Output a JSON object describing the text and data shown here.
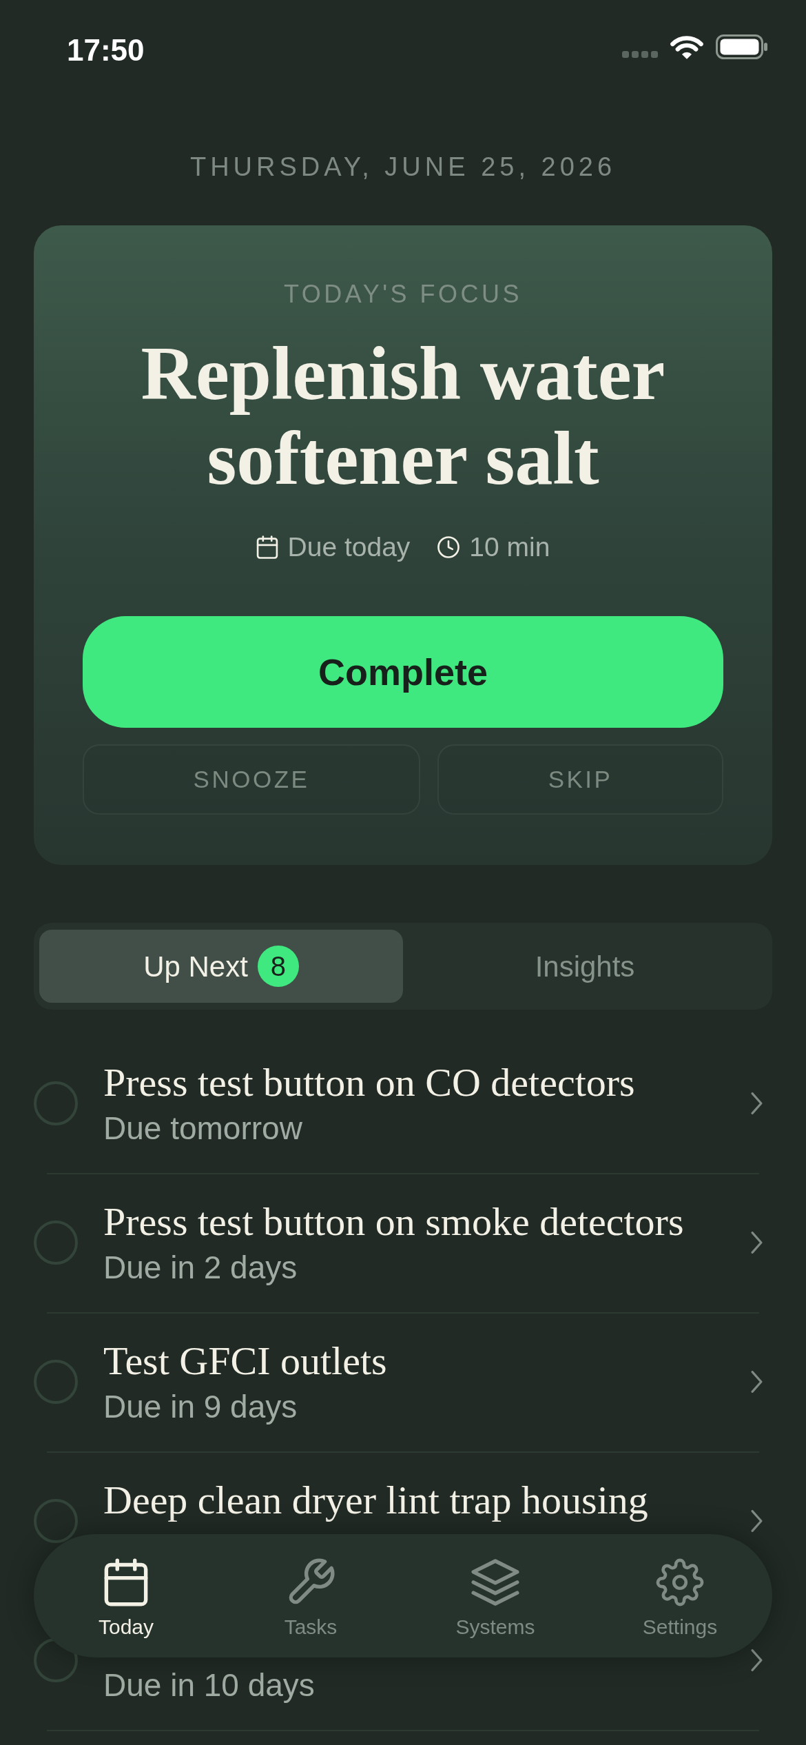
{
  "status_bar": {
    "time": "17:50"
  },
  "date": "THURSDAY, JUNE 25, 2026",
  "focus": {
    "label": "TODAY'S FOCUS",
    "title": "Replenish water softener salt",
    "meta": [
      {
        "kind": "due",
        "text": "Due today"
      },
      {
        "kind": "duration",
        "text": "10 min"
      }
    ],
    "primary_action": "Complete",
    "secondary_actions": [
      "SNOOZE",
      "SKIP"
    ]
  },
  "tabs": [
    {
      "label": "Up Next",
      "badge": "8",
      "selected": true
    },
    {
      "label": "Insights",
      "selected": false
    }
  ],
  "tasks": [
    {
      "title": "Press test button on CO detectors",
      "due": "Due tomorrow",
      "checked": false
    },
    {
      "title": "Press test button on smoke detectors",
      "due": "Due in 2 days",
      "checked": false
    },
    {
      "title": "Test GFCI outlets",
      "due": "Due in 9 days",
      "checked": false
    },
    {
      "title": "Deep clean dryer lint trap housing",
      "checked": false
    },
    {
      "due": "Due in 10 days",
      "checked": false
    }
  ],
  "tab_bar": [
    {
      "label": "Today",
      "selected": true
    },
    {
      "label": "Tasks",
      "selected": false
    },
    {
      "label": "Systems",
      "selected": false
    },
    {
      "label": "Settings",
      "selected": false
    }
  ]
}
